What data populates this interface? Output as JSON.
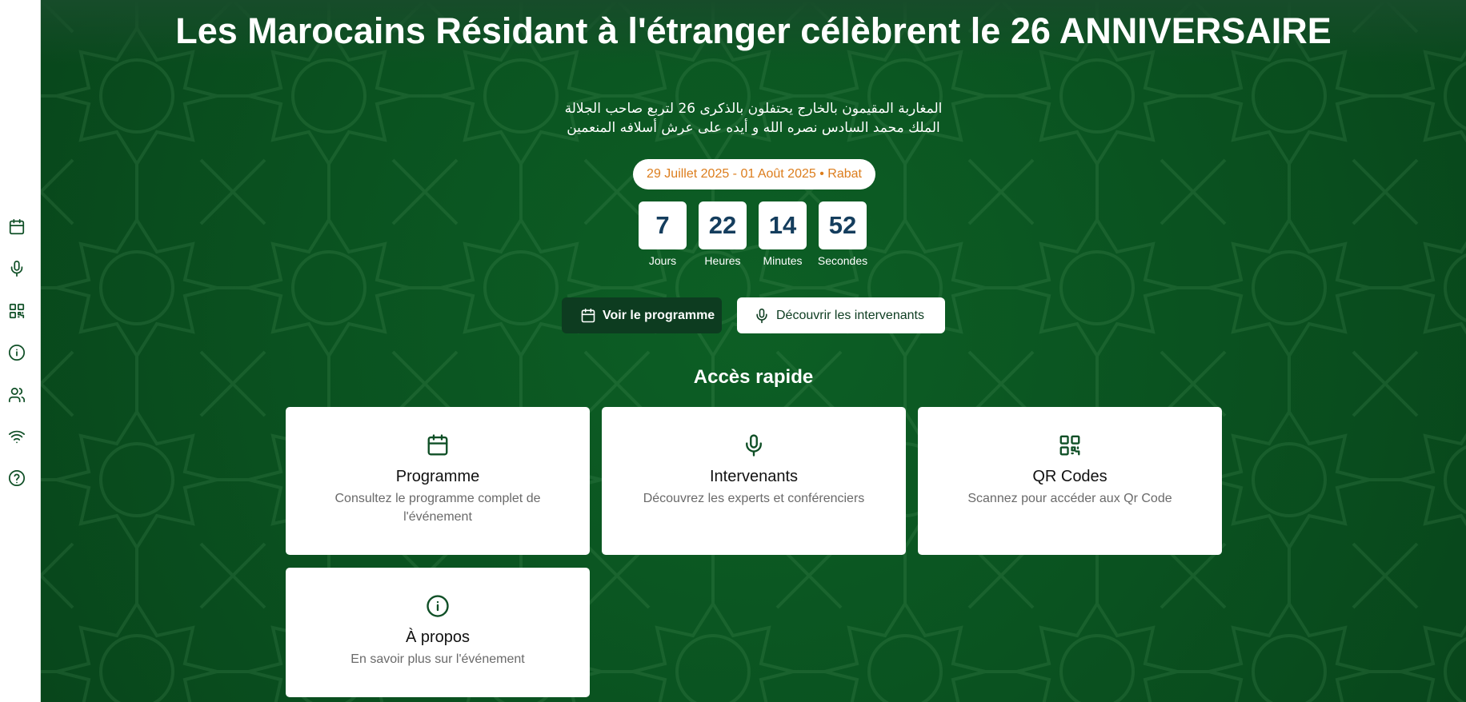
{
  "hero": {
    "title": "Les Marocains Résidant à l'étranger célèbrent le 26 ANNIVERSAIRE",
    "arabic_line1": "المغاربة المقيمون بالخارج يحتفلون بالذكرى 26 لتربع صاحب الجلالة",
    "arabic_line2": "الملك محمد السادس نصره الله و أيده على عرش أسلافه المنعمين",
    "date_location": "29 Juillet 2025 - 01 Août 2025 • Rabat"
  },
  "countdown": [
    {
      "value": "7",
      "label": "Jours"
    },
    {
      "value": "22",
      "label": "Heures"
    },
    {
      "value": "14",
      "label": "Minutes"
    },
    {
      "value": "52",
      "label": "Secondes"
    }
  ],
  "actions": {
    "programme_label": "Voir le programme",
    "speakers_label": "Découvrir les intervenants"
  },
  "quick_access": {
    "title": "Accès rapide",
    "cards": [
      {
        "icon": "calendar-icon",
        "title": "Programme",
        "description": "Consultez le programme complet de l'événement"
      },
      {
        "icon": "microphone-icon",
        "title": "Intervenants",
        "description": "Découvrez les experts et conférenciers"
      },
      {
        "icon": "qr-code-icon",
        "title": "QR Codes",
        "description": "Scannez pour accéder aux Qr Code"
      },
      {
        "icon": "info-icon",
        "title": "À propos",
        "description": "En savoir plus sur l'événement"
      }
    ]
  },
  "sidebar": {
    "icons": [
      "calendar-icon",
      "microphone-icon",
      "qr-code-icon",
      "info-icon",
      "users-icon",
      "wifi-icon",
      "help-icon"
    ]
  },
  "colors": {
    "background": "#0b5a22",
    "sidebar": "#ffffff",
    "primary_dark": "#0d3c20",
    "accent_orange": "#dc7d1c",
    "countdown_text": "#143d5d"
  }
}
